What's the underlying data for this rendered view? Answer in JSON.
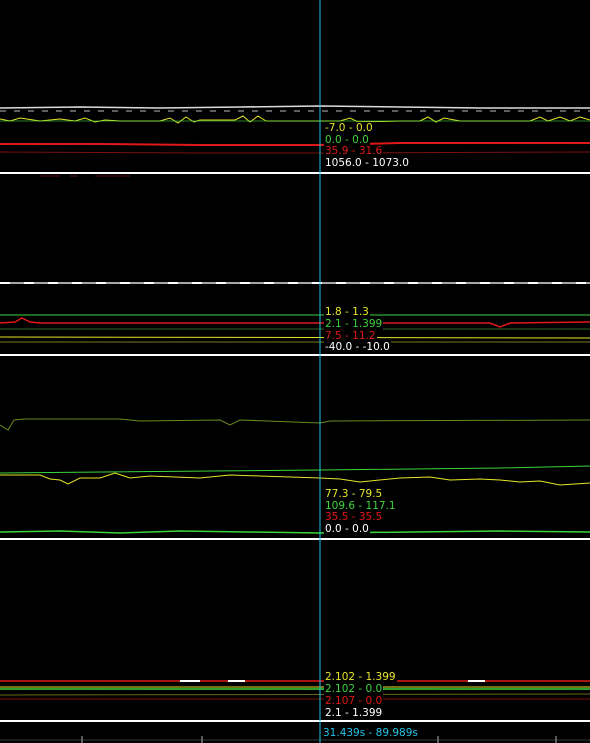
{
  "colors": {
    "background": "#000000",
    "divider": "#ffffff",
    "cursor": "#1ec8e6",
    "yellow": "#e6e629",
    "green": "#3cd43c",
    "red": "#e01818",
    "white": "#ffffff"
  },
  "panels": [
    {
      "id": "panel-1",
      "readouts": [
        {
          "text": "-7.0 - 0.0",
          "color": "yellow"
        },
        {
          "text": "0.0 - 0.0",
          "color": "green"
        },
        {
          "text": "35.9 - 31.6",
          "color": "red"
        },
        {
          "text": "1056.0 - 1073.0",
          "color": "white"
        }
      ]
    },
    {
      "id": "panel-2",
      "readouts": [
        {
          "text": "1.8 - 1.3",
          "color": "yellow"
        },
        {
          "text": "2.1 - 1.399",
          "color": "green"
        },
        {
          "text": "7.5 - 11.2",
          "color": "red"
        },
        {
          "text": "-40.0 - -10.0",
          "color": "white"
        }
      ]
    },
    {
      "id": "panel-3",
      "readouts": [
        {
          "text": "77.3 - 79.5",
          "color": "yellow"
        },
        {
          "text": "109.6 - 117.1",
          "color": "green"
        },
        {
          "text": "35.5 - 35.5",
          "color": "red"
        },
        {
          "text": "0.0 - 0.0",
          "color": "white"
        }
      ]
    },
    {
      "id": "panel-4",
      "readouts": [
        {
          "text": "2.102 - 1.399",
          "color": "yellow"
        },
        {
          "text": "2.102 - 0.0",
          "color": "green"
        },
        {
          "text": "2.107 - 0.0",
          "color": "red"
        },
        {
          "text": "2.1 - 1.399",
          "color": "white"
        }
      ]
    }
  ],
  "cursor_readout": "31.439s - 89.989s"
}
